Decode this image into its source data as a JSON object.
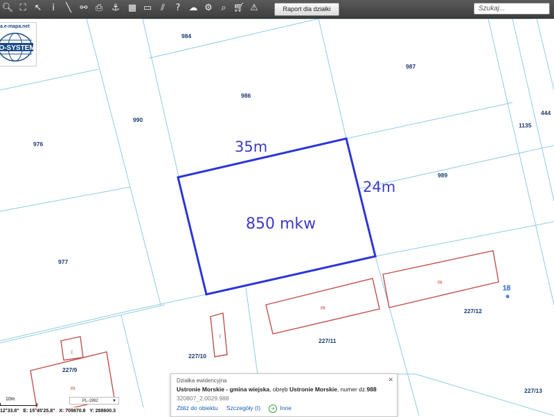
{
  "toolbar": {
    "report_button_label": "Raport dla działki",
    "search_placeholder": "Szukaj...",
    "tools": [
      {
        "icon": "zoom-out-icon",
        "glyph": "🔍︎"
      },
      {
        "icon": "zoom-extent-icon",
        "glyph": "⛶"
      },
      {
        "icon": "pointer-icon",
        "glyph": "↖"
      },
      {
        "icon": "info-icon",
        "glyph": "i"
      },
      {
        "icon": "measure-line-icon",
        "glyph": "╲"
      },
      {
        "icon": "link-icon",
        "glyph": "⚯"
      },
      {
        "icon": "print-icon",
        "glyph": "⎙"
      },
      {
        "icon": "anchor-icon",
        "glyph": "⚓"
      },
      {
        "icon": "layout-icon",
        "glyph": "▦"
      },
      {
        "icon": "layers-icon",
        "glyph": "▭"
      },
      {
        "icon": "hatch-icon",
        "glyph": "⫽"
      },
      {
        "icon": "help-icon",
        "glyph": "?"
      },
      {
        "icon": "cloud-upload-icon",
        "glyph": "☁"
      },
      {
        "icon": "settings-icon",
        "glyph": "⚙"
      },
      {
        "icon": "search-map-icon",
        "glyph": "⌕"
      },
      {
        "icon": "cart-icon",
        "glyph": "🛒︎"
      },
      {
        "icon": "warning-icon",
        "glyph": "⚠"
      }
    ]
  },
  "logo": {
    "url_text": "a.e-mapa.net",
    "brand": "GEO-SYSTEM"
  },
  "map": {
    "parcels": [
      "984",
      "987",
      "986",
      "990",
      "444",
      "1135",
      "976",
      "989",
      "977",
      "227/12",
      "227/11",
      "227/10",
      "227/9",
      "227/13"
    ],
    "building_labels": [
      "m",
      "m",
      "i",
      "i",
      "m"
    ],
    "point_label": "18",
    "annotations": {
      "width": "35m",
      "height": "24m",
      "area": "850 mkw"
    }
  },
  "status": {
    "lat": "12°33.8\"",
    "lon": "E: 15°45'25.8\"",
    "x": "X: 709870.8",
    "y": "Y: 288600.3",
    "scale_label": "10m",
    "crs": "PL-1992"
  },
  "popup": {
    "header": "Działka ewidencyjna",
    "municipality": "Ustronie Morskie - gmina wiejska",
    "obreb_label": ", obręb ",
    "obreb": "Ustronie Morskie",
    "number_label": ", numer dz.",
    "number": "988",
    "identifier": "320807_2.0029.988",
    "links": {
      "zoom": "Zbliż do obiektu",
      "details": "Szczegóły (I)",
      "other": "Inne"
    }
  },
  "colors": {
    "parcel_line": "#8ecbe0",
    "building": "#c0504d",
    "annotation": "#3b3bc4",
    "selection": "#2b35d8"
  }
}
